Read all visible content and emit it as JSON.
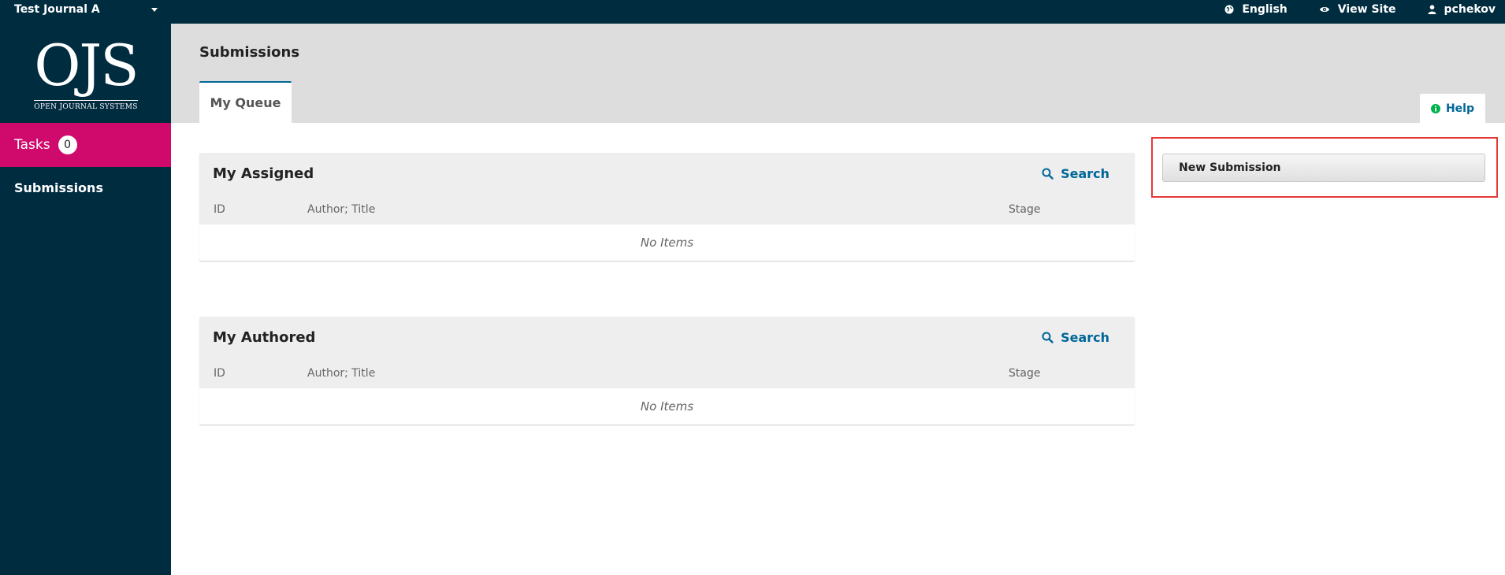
{
  "topbar": {
    "journal_name": "Test Journal A",
    "language_label": "English",
    "view_site_label": "View Site",
    "username": "pchekov"
  },
  "sidebar": {
    "logo_mark": "OJS",
    "logo_subtitle": "OPEN JOURNAL SYSTEMS",
    "tasks_label": "Tasks",
    "tasks_count": "0",
    "submissions_label": "Submissions"
  },
  "header": {
    "title": "Submissions",
    "tabs": [
      {
        "label": "My Queue"
      }
    ],
    "help_label": "Help"
  },
  "panels": [
    {
      "title": "My Assigned",
      "search_label": "Search",
      "columns": [
        "ID",
        "Author; Title",
        "Stage"
      ],
      "empty_text": "No Items"
    },
    {
      "title": "My Authored",
      "search_label": "Search",
      "columns": [
        "ID",
        "Author; Title",
        "Stage"
      ],
      "empty_text": "No Items"
    }
  ],
  "actions": {
    "new_submission_label": "New Submission"
  },
  "colors": {
    "navy": "#002c40",
    "tasks_pink": "#d00a6c",
    "link_blue": "#006798",
    "highlight_red": "#e53935"
  }
}
